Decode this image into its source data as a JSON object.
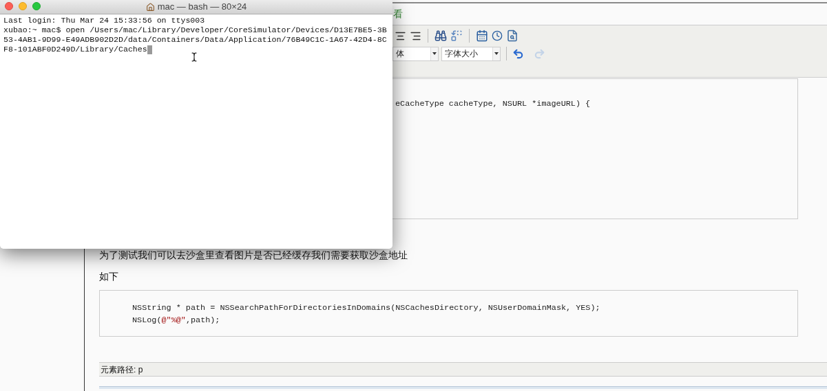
{
  "terminal": {
    "title": "mac — bash — 80×24",
    "cursor_shown": true,
    "lines": [
      "Last login: Thu Mar 24 15:33:56 on ttys003",
      "xubao:~ mac$ open /Users/mac/Library/Developer/CoreSimulator/Devices/D13E7BE5-3B",
      "53-4AB1-9D99-E49ADB902D2D/data/Containers/Data/Application/76B49C1C-1A67-42D4-8C",
      "F8-101ABF0D249D/Library/Caches"
    ]
  },
  "editor": {
    "tab_fragment": "看",
    "toolbar": {
      "font_family": "体",
      "font_size": "字体大小",
      "undo": {
        "disabled": false
      },
      "redo": {
        "disabled": true
      }
    },
    "code_block_1": [
      "eCacheType cacheType, NSURL *imageURL) {"
    ],
    "paragraphs": [
      "为了测试我们可以去沙盒里查看图片是否已经缓存我们需要获取沙盒地址",
      "如下"
    ],
    "code_block_2": [
      [
        {
          "kind": "plain",
          "text": "NSString * path = NSSearchPathForDirectoriesInDomains(NSCachesDirectory, NSUserDomainMask, YES);"
        }
      ],
      [
        {
          "kind": "plain",
          "text": "NSLog("
        },
        {
          "kind": "string",
          "text": "@\"%@\""
        },
        {
          "kind": "plain",
          "text": ",path);"
        }
      ]
    ],
    "status_bar": "元素路径: p"
  }
}
